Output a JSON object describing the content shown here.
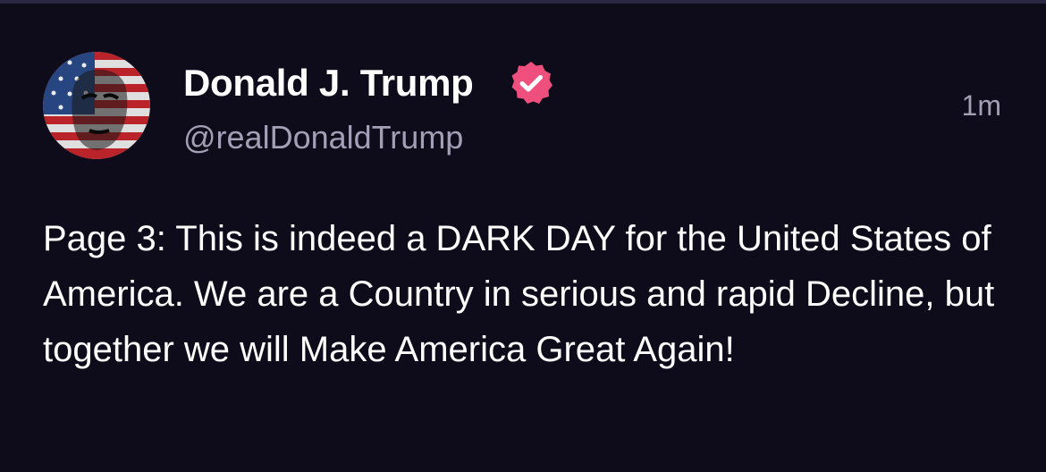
{
  "post": {
    "author": {
      "display_name": "Donald J. Trump",
      "handle": "@realDonaldTrump",
      "verified": true,
      "avatar": "avatar-american-flag-portrait"
    },
    "timestamp": "1m",
    "body": "Page 3: This is indeed a DARK DAY for the United States of America. We are a Country in serious and rapid Decline, but together we will Make America Great Again!"
  },
  "colors": {
    "background": "#0e0b1a",
    "text_primary": "#ffffff",
    "text_secondary": "#a29fb6",
    "verified_badge": "#ef4f7c"
  }
}
